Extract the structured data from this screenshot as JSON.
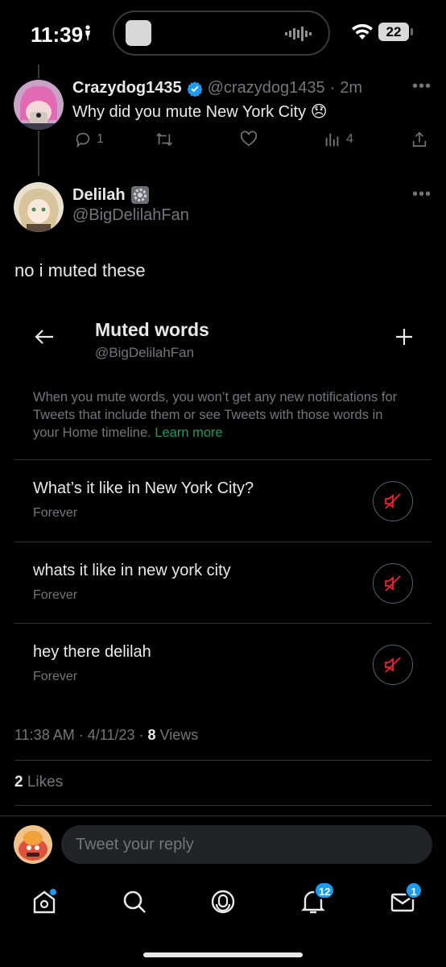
{
  "status": {
    "time": "11:39",
    "battery": "22"
  },
  "tweet1": {
    "name": "Crazydog1435",
    "handle": "@crazydog1435",
    "dot": "·",
    "age": "2m",
    "text": "Why did you mute New York City",
    "emoji": "😞",
    "replies": "1",
    "views": "4"
  },
  "tweet2": {
    "name": "Delilah",
    "badge_emoji": "⚙️",
    "handle": "@BigDelilahFan",
    "text": "no i muted these"
  },
  "embed": {
    "title": "Muted words",
    "subtitle": "@BigDelilahFan",
    "description": "When you mute words, you won’t get any new notifications for Tweets that include them or see Tweets with those words in your Home timeline.",
    "learn_more": "Learn more",
    "muted": [
      {
        "word": "What’s it like in New York City?",
        "duration": "Forever"
      },
      {
        "word": "whats it like in new york city",
        "duration": "Forever"
      },
      {
        "word": "hey there delilah",
        "duration": "Forever"
      }
    ]
  },
  "meta": {
    "time": "11:38 AM",
    "dot": "·",
    "date": "4/11/23",
    "views_count": "8",
    "views_label": "Views"
  },
  "likes": {
    "count": "2",
    "label": "Likes"
  },
  "reply": {
    "placeholder": "Tweet your reply"
  },
  "tabs": {
    "notifications_badge": "12",
    "messages_badge": "1"
  },
  "colors": {
    "accent": "#1d9bf0",
    "mute_red": "#f4212e",
    "learn_more": "#1d9b5e"
  }
}
